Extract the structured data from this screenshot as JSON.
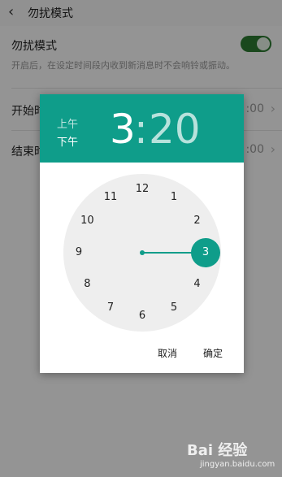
{
  "header": {
    "title": "勿扰模式"
  },
  "dnd": {
    "label": "勿扰模式",
    "description": "开启后，在设定时间段内收到新消息时不会响铃或振动。"
  },
  "rows": [
    {
      "label": "开始时",
      "value": ":00"
    },
    {
      "label": "结束时",
      "value": ":00"
    }
  ],
  "time_picker": {
    "am_label": "上午",
    "pm_label": "下午",
    "selected_period": "下午",
    "hour": "3",
    "separator": ":",
    "minute": "20",
    "numbers": [
      "12",
      "1",
      "2",
      "3",
      "4",
      "5",
      "6",
      "7",
      "8",
      "9",
      "10",
      "11"
    ],
    "selected_number": "3",
    "cancel_label": "取消",
    "ok_label": "确定"
  },
  "colors": {
    "accent": "#0f9d8a",
    "toggle_on": "#2e7d32"
  },
  "watermark": {
    "text": "Bai 经验",
    "sub": "jingyan.baidu.com"
  }
}
